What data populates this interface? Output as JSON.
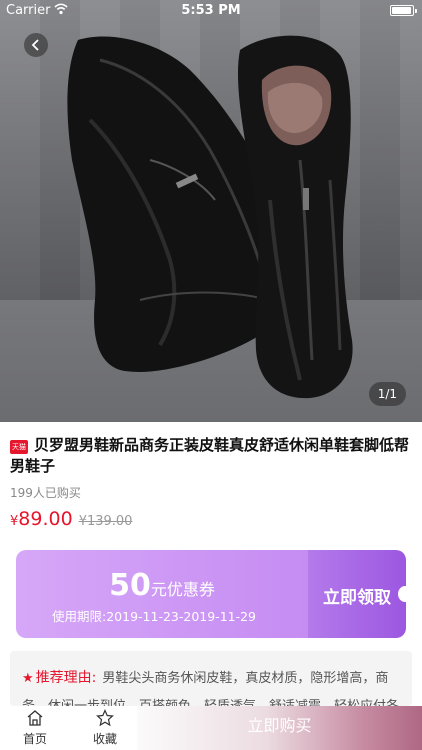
{
  "status_bar": {
    "carrier": "Carrier",
    "time": "5:53 PM"
  },
  "hero": {
    "image_counter": "1/1",
    "back_icon": "chevron-left-icon"
  },
  "product": {
    "platform_badge": "天猫",
    "title": "贝罗盟男鞋新品商务正装皮鞋真皮舒适休闲单鞋套脚低帮男鞋子",
    "sold_count": "199人已购买",
    "price_symbol": "¥",
    "price": "89.00",
    "original_price": "¥139.00"
  },
  "coupon": {
    "amount": "50",
    "unit": "元优惠券",
    "validity": "使用期限:2019-11-23-2019-11-29",
    "claim_label": "立即领取"
  },
  "reason": {
    "label": "推荐理由:",
    "text": "男鞋尖头商务休闲皮鞋，真皮材质，隐形增高，商务，休闲一步到位，百搭颜色，轻质透气，舒适减震，轻松应付各种"
  },
  "tabbar": {
    "home_label": "首页",
    "favorite_label": "收藏",
    "buy_label": "立即购买"
  },
  "colors": {
    "accent_red": "#e6162d",
    "coupon_purple": "#b47aeb"
  }
}
